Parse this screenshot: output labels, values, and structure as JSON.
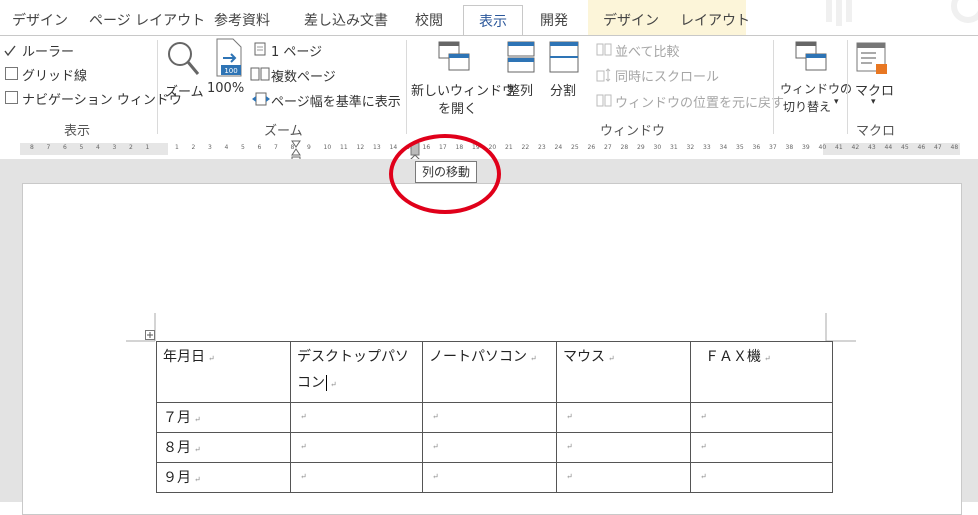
{
  "tabs": [
    {
      "label": "デザイン",
      "active": false
    },
    {
      "label": "ページ レイアウト",
      "active": false
    },
    {
      "label": "参考資料",
      "active": false
    },
    {
      "label": "差し込み文書",
      "active": false
    },
    {
      "label": "校閲",
      "active": false
    },
    {
      "label": "表示",
      "active": true
    },
    {
      "label": "開発",
      "active": false
    },
    {
      "label": "デザイン",
      "active": false,
      "contextual": true
    },
    {
      "label": "レイアウト",
      "active": false,
      "contextual": true
    }
  ],
  "ribbon": {
    "show_group": {
      "label": "表示",
      "items": [
        {
          "label": "ルーラー",
          "checked": true
        },
        {
          "label": "グリッド線",
          "checked": false
        },
        {
          "label": "ナビゲーション ウィンドウ",
          "checked": false
        }
      ]
    },
    "zoom_group": {
      "label": "ズーム",
      "zoom_label": "ズーム",
      "hundred_label": "100%",
      "hundred_icon_text": "100",
      "one_page": "1 ページ",
      "multi_page": "複数ページ",
      "page_width": "ページ幅を基準に表示"
    },
    "window_group": {
      "label": "ウィンドウ",
      "new_window": [
        "新しいウィンドウ",
        "を開く"
      ],
      "arrange": "整列",
      "split": "分割",
      "side_by_side": "並べて比較",
      "sync_scroll": "同時にスクロール",
      "reset_pos": "ウィンドウの位置を元に戻す",
      "switch": [
        "ウィンドウの",
        "切り替え"
      ]
    },
    "macro_group": {
      "label": "マクロ",
      "macro": "マクロ"
    }
  },
  "ruler_left": [
    "8",
    "7",
    "6",
    "5",
    "4",
    "3",
    "2",
    "1"
  ],
  "ruler_right": [
    "1",
    "2",
    "3",
    "4",
    "5",
    "6",
    "7",
    "8",
    "9",
    "10",
    "11",
    "12",
    "13",
    "14",
    "15",
    "16",
    "17",
    "18",
    "19",
    "20",
    "21",
    "22",
    "23",
    "24",
    "25",
    "26",
    "27",
    "28",
    "29",
    "30",
    "31",
    "32",
    "33",
    "34",
    "35",
    "36",
    "37",
    "38",
    "39",
    "40",
    "41",
    "42",
    "43",
    "44",
    "45",
    "46",
    "47",
    "48"
  ],
  "tooltip": "列の移動",
  "table": {
    "header": [
      "年月日",
      "デスクトップパソコン",
      "ノートパソコン",
      "マウス",
      "ＦＡＸ機"
    ],
    "rows": [
      [
        "７月",
        "",
        "",
        "",
        ""
      ],
      [
        "８月",
        "",
        "",
        "",
        ""
      ],
      [
        "９月",
        "",
        "",
        "",
        ""
      ]
    ]
  },
  "colors": {
    "active_tab": "#2b579a",
    "contextual_bg": "#fcf5d9",
    "highlight_circle": "#e0001a"
  }
}
